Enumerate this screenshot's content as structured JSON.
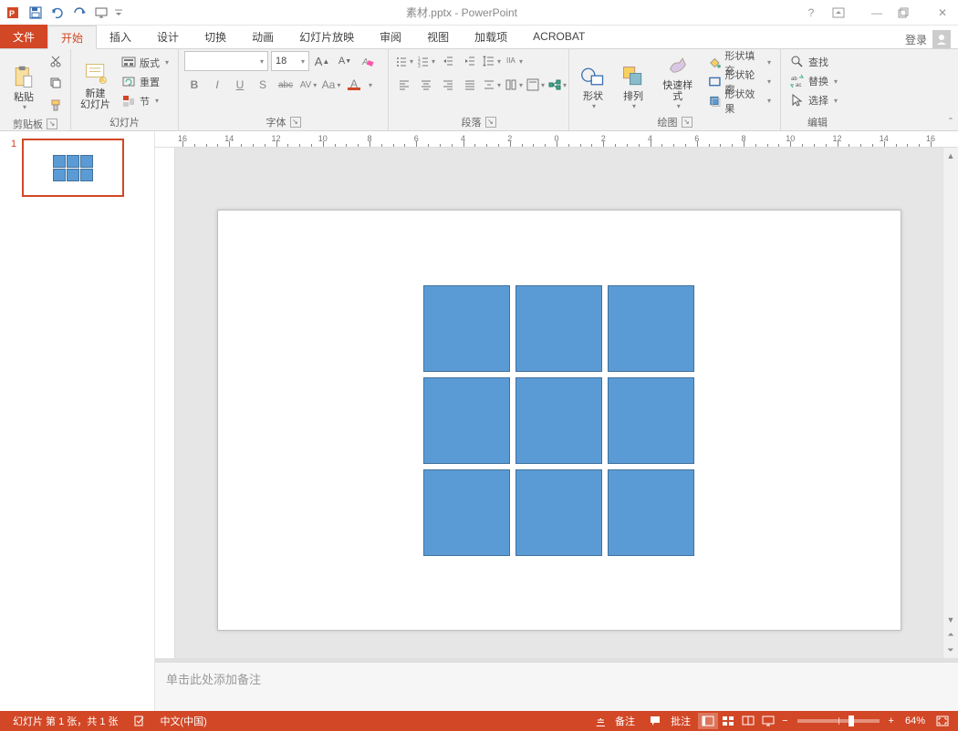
{
  "window": {
    "title": "素材.pptx - PowerPoint"
  },
  "qat": {
    "save": "保存",
    "undo": "撤销",
    "redo": "恢复",
    "startFromBeginning": "从头开始"
  },
  "tabs": {
    "file": "文件",
    "login": "登录",
    "items": [
      "开始",
      "插入",
      "设计",
      "切换",
      "动画",
      "幻灯片放映",
      "审阅",
      "视图",
      "加载项",
      "ACROBAT"
    ],
    "activeIndex": 0
  },
  "ribbon": {
    "clipboard": {
      "label": "剪贴板",
      "paste": "粘贴"
    },
    "slides": {
      "label": "幻灯片",
      "newSlide": "新建\n幻灯片",
      "layout": "版式",
      "reset": "重置",
      "section": "节"
    },
    "font": {
      "label": "字体",
      "fontName": "",
      "fontSize": "18"
    },
    "paragraph": {
      "label": "段落"
    },
    "drawing": {
      "label": "绘图",
      "shapes": "形状",
      "arrange": "排列",
      "quickStyles": "快速样式",
      "shapeFill": "形状填充",
      "shapeOutline": "形状轮廓",
      "shapeEffects": "形状效果"
    },
    "editing": {
      "label": "编辑",
      "find": "查找",
      "replace": "替换",
      "select": "选择"
    }
  },
  "thumbnail": {
    "number": "1"
  },
  "ruler": {
    "marks": [
      "16",
      "14",
      "12",
      "10",
      "8",
      "6",
      "4",
      "2",
      "0",
      "2",
      "4",
      "6",
      "8",
      "10",
      "12",
      "14",
      "16"
    ]
  },
  "notes": {
    "placeholder": "单击此处添加备注"
  },
  "status": {
    "slideInfo": "幻灯片 第 1 张，共 1 张",
    "language": "中文(中国)",
    "notesBtn": "备注",
    "commentsBtn": "批注",
    "zoomPct": "64%"
  }
}
